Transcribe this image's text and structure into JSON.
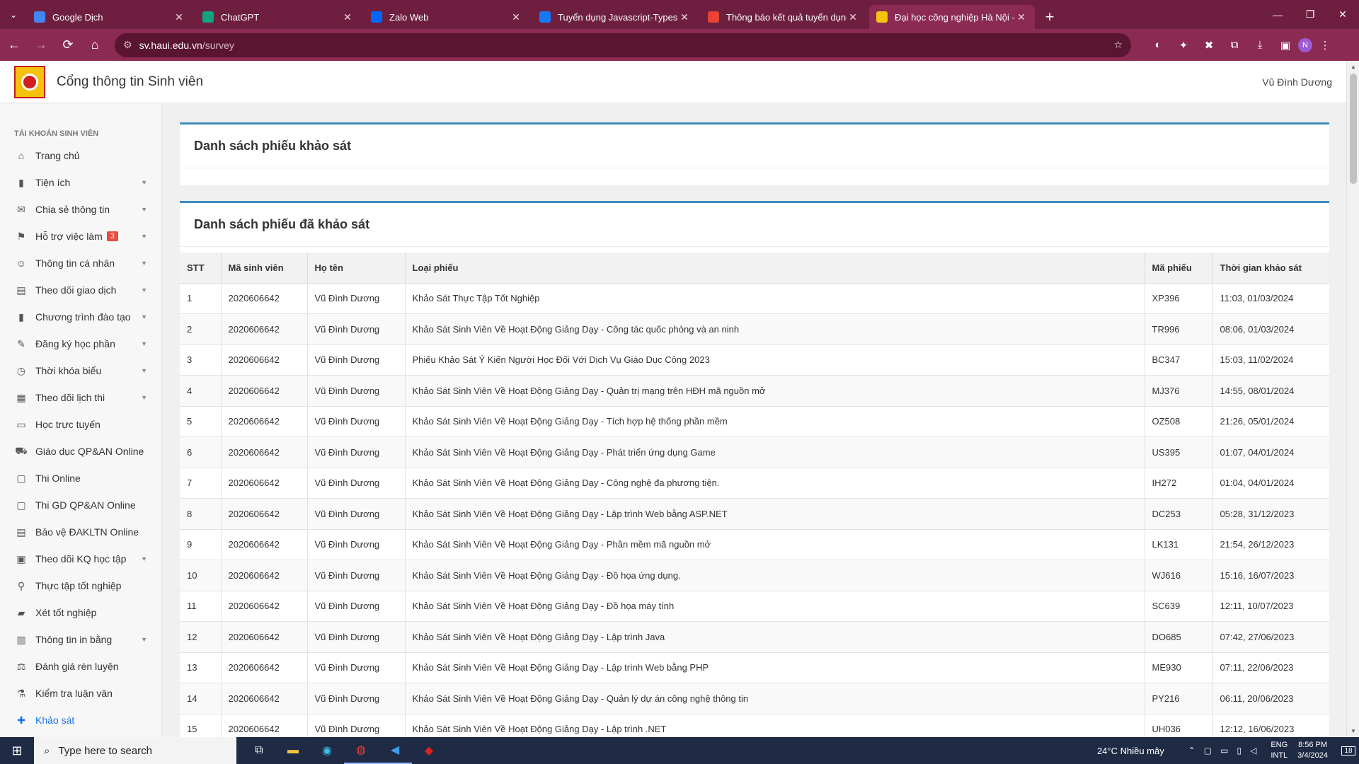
{
  "browser": {
    "tabs": [
      {
        "title": "Google Dịch",
        "favicon": "google-translate-icon",
        "color": "#4285f4"
      },
      {
        "title": "ChatGPT",
        "favicon": "chatgpt-icon",
        "color": "#10a37f"
      },
      {
        "title": "Zalo Web",
        "favicon": "zalo-icon",
        "color": "#0068ff"
      },
      {
        "title": "Tuyển dụng Javascript-Typescript",
        "favicon": "facebook-icon",
        "color": "#1877f2"
      },
      {
        "title": "Thông báo kết quả tuyển dụng",
        "favicon": "gmail-icon",
        "color": "#ea4335"
      },
      {
        "title": "Đại học công nghiệp Hà Nội - C",
        "favicon": "haui-icon",
        "color": "#f4c20d"
      }
    ],
    "url_host": "sv.haui.edu.vn",
    "url_path": "/survey"
  },
  "app": {
    "title": "Cổng thông tin Sinh viên",
    "user": "Vũ Đình Dương"
  },
  "sidebar": {
    "section": "TÀI KHOẢN SINH VIÊN",
    "items": [
      {
        "label": "Trang chủ",
        "icon": "home-icon",
        "caret": false
      },
      {
        "label": "Tiện ích",
        "icon": "book-icon",
        "caret": true
      },
      {
        "label": "Chia sẻ thông tin",
        "icon": "chat-icon",
        "caret": true
      },
      {
        "label": "Hỗ trợ việc làm",
        "icon": "job-icon",
        "caret": true,
        "badge": "3"
      },
      {
        "label": "Thông tin cá nhân",
        "icon": "user-icon",
        "caret": true
      },
      {
        "label": "Theo dõi giao dịch",
        "icon": "ledger-icon",
        "caret": true
      },
      {
        "label": "Chương trình đào tạo",
        "icon": "book-icon",
        "caret": true
      },
      {
        "label": "Đăng ký học phần",
        "icon": "register-icon",
        "caret": true
      },
      {
        "label": "Thời khóa biểu",
        "icon": "clock-icon",
        "caret": true
      },
      {
        "label": "Theo dõi lịch thi",
        "icon": "calendar-icon",
        "caret": true
      },
      {
        "label": "Học trực tuyến",
        "icon": "laptop-icon",
        "caret": false
      },
      {
        "label": "Giáo dục QP&AN Online",
        "icon": "bus-icon",
        "caret": false
      },
      {
        "label": "Thi Online",
        "icon": "exam-icon",
        "caret": false
      },
      {
        "label": "Thi GD QP&AN Online",
        "icon": "exam-icon",
        "caret": false
      },
      {
        "label": "Bảo vệ ĐAKLTN Online",
        "icon": "ledger-icon",
        "caret": false
      },
      {
        "label": "Theo dõi KQ học tập",
        "icon": "result-icon",
        "caret": true
      },
      {
        "label": "Thực tập tốt nghiệp",
        "icon": "sitemap-icon",
        "caret": false
      },
      {
        "label": "Xét tốt nghiệp",
        "icon": "graduation-icon",
        "caret": false
      },
      {
        "label": "Thông tin in bằng",
        "icon": "print-icon",
        "caret": true
      },
      {
        "label": "Đánh giá rèn luyện",
        "icon": "scale-icon",
        "caret": false
      },
      {
        "label": "Kiểm tra luận văn",
        "icon": "flask-icon",
        "caret": false
      },
      {
        "label": "Khảo sát",
        "icon": "survey-icon",
        "caret": false,
        "active": true
      }
    ]
  },
  "main": {
    "box1_title": "Danh sách phiếu khảo sát",
    "box2_title": "Danh sách phiếu đã khảo sát",
    "columns": [
      "STT",
      "Mã sinh viên",
      "Họ tên",
      "Loại phiếu",
      "Mã phiếu",
      "Thời gian khảo sát"
    ],
    "rows": [
      [
        "1",
        "2020606642",
        "Vũ Đình Dương",
        "Khảo Sát Thực Tập Tốt Nghiệp",
        "XP396",
        "11:03, 01/03/2024"
      ],
      [
        "2",
        "2020606642",
        "Vũ Đình Dương",
        "Khảo Sát Sinh Viên Về Hoạt Động Giảng Dạy - Công tác quốc phòng và an ninh",
        "TR996",
        "08:06, 01/03/2024"
      ],
      [
        "3",
        "2020606642",
        "Vũ Đình Dương",
        "Phiếu Khảo Sát Ý Kiến Người Học Đối Với Dịch Vụ Giáo Dục Công 2023",
        "BC347",
        "15:03, 11/02/2024"
      ],
      [
        "4",
        "2020606642",
        "Vũ Đình Dương",
        "Khảo Sát Sinh Viên Về Hoạt Động Giảng Dạy - Quản trị mạng trên HĐH mã nguồn mở",
        "MJ376",
        "14:55, 08/01/2024"
      ],
      [
        "5",
        "2020606642",
        "Vũ Đình Dương",
        "Khảo Sát Sinh Viên Về Hoạt Động Giảng Dạy - Tích hợp hệ thống phần mềm",
        "OZ508",
        "21:26, 05/01/2024"
      ],
      [
        "6",
        "2020606642",
        "Vũ Đình Dương",
        "Khảo Sát Sinh Viên Về Hoạt Động Giảng Dạy - Phát triển ứng dụng Game",
        "US395",
        "01:07, 04/01/2024"
      ],
      [
        "7",
        "2020606642",
        "Vũ Đình Dương",
        "Khảo Sát Sinh Viên Về Hoạt Động Giảng Dạy - Công nghệ đa phương tiện.",
        "IH272",
        "01:04, 04/01/2024"
      ],
      [
        "8",
        "2020606642",
        "Vũ Đình Dương",
        "Khảo Sát Sinh Viên Về Hoạt Động Giảng Dạy - Lập trình Web bằng ASP.NET",
        "DC253",
        "05:28, 31/12/2023"
      ],
      [
        "9",
        "2020606642",
        "Vũ Đình Dương",
        "Khảo Sát Sinh Viên Về Hoạt Động Giảng Dạy - Phần mềm mã nguồn mở",
        "LK131",
        "21:54, 26/12/2023"
      ],
      [
        "10",
        "2020606642",
        "Vũ Đình Dương",
        "Khảo Sát Sinh Viên Về Hoạt Động Giảng Dạy - Đồ họa ứng dụng.",
        "WJ616",
        "15:16, 16/07/2023"
      ],
      [
        "11",
        "2020606642",
        "Vũ Đình Dương",
        "Khảo Sát Sinh Viên Về Hoạt Động Giảng Dạy - Đồ họa máy tính",
        "SC639",
        "12:11, 10/07/2023"
      ],
      [
        "12",
        "2020606642",
        "Vũ Đình Dương",
        "Khảo Sát Sinh Viên Về Hoạt Động Giảng Dạy - Lập trình Java",
        "DO685",
        "07:42, 27/06/2023"
      ],
      [
        "13",
        "2020606642",
        "Vũ Đình Dương",
        "Khảo Sát Sinh Viên Về Hoạt Động Giảng Dạy - Lập trình Web bằng PHP",
        "ME930",
        "07:11, 22/06/2023"
      ],
      [
        "14",
        "2020606642",
        "Vũ Đình Dương",
        "Khảo Sát Sinh Viên Về Hoạt Động Giảng Dạy - Quản lý dự án công nghệ thông tin",
        "PY216",
        "06:11, 20/06/2023"
      ],
      [
        "15",
        "2020606642",
        "Vũ Đình Dương",
        "Khảo Sát Sinh Viên Về Hoạt Động Giảng Dạy - Lập trình .NET",
        "UH036",
        "12:12, 16/06/2023"
      ]
    ]
  },
  "taskbar": {
    "search_placeholder": "Type here to search",
    "weather": "24°C  Nhiều mây",
    "lang1": "ENG",
    "lang2": "INTL",
    "time": "8:56 PM",
    "date": "3/4/2024",
    "notifications": "18"
  },
  "colors": {
    "tabstrip": "#6e1f3f",
    "toolbar": "#8b2a52",
    "accent": "#3c8dbc",
    "active_link": "#1a73e8"
  }
}
